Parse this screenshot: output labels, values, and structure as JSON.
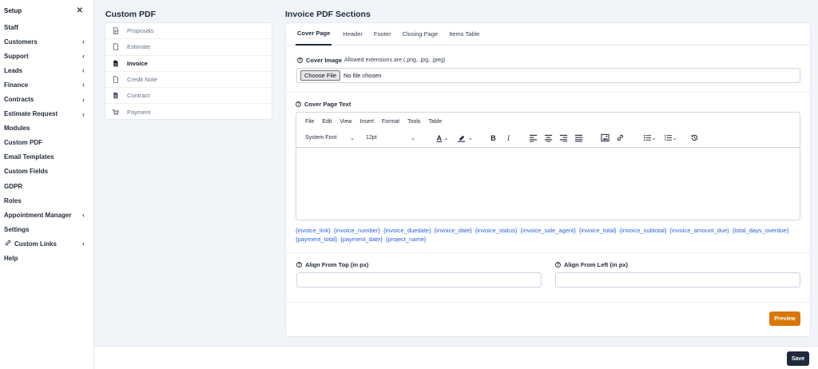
{
  "sidebar": {
    "title": "Setup",
    "close_glyph": "✕",
    "items": [
      {
        "label": "Staff",
        "chevron": false
      },
      {
        "label": "Customers",
        "chevron": true
      },
      {
        "label": "Support",
        "chevron": true
      },
      {
        "label": "Leads",
        "chevron": true
      },
      {
        "label": "Finance",
        "chevron": true
      },
      {
        "label": "Contracts",
        "chevron": true
      },
      {
        "label": "Estimate Request",
        "chevron": true
      },
      {
        "label": "Modules",
        "chevron": false
      },
      {
        "label": "Custom PDF",
        "chevron": false
      },
      {
        "label": "Email Templates",
        "chevron": false
      },
      {
        "label": "Custom Fields",
        "chevron": false
      },
      {
        "label": "GDPR",
        "chevron": false
      },
      {
        "label": "Roles",
        "chevron": false
      },
      {
        "label": "Appointment Manager",
        "chevron": true
      },
      {
        "label": "Settings",
        "chevron": false
      },
      {
        "label": "Custom Links",
        "chevron": true,
        "icon": "link-icon"
      },
      {
        "label": "Help",
        "chevron": false
      }
    ]
  },
  "custom_pdf": {
    "title": "Custom PDF",
    "items": [
      {
        "label": "Proposals",
        "icon": "document-icon",
        "active": false
      },
      {
        "label": "Estimate",
        "icon": "file-outline-icon",
        "active": false
      },
      {
        "label": "Invoice",
        "icon": "invoice-icon",
        "active": true
      },
      {
        "label": "Credit Note",
        "icon": "credit-note-icon",
        "active": false
      },
      {
        "label": "Contract",
        "icon": "contract-icon",
        "active": false
      },
      {
        "label": "Payment",
        "icon": "cart-icon",
        "active": false
      }
    ]
  },
  "sections": {
    "title": "Invoice PDF Sections",
    "tabs": [
      "Cover Page",
      "Header",
      "Footer",
      "Closing Page",
      "Items Table"
    ],
    "active_tab": 0,
    "cover_image": {
      "label": "Cover Image",
      "hint": "Allowed extensions are (.png, .jpg, .jpeg)",
      "button": "Choose File",
      "status": "No file chosen"
    },
    "cover_text": {
      "label": "Cover Page Text",
      "menus": [
        "File",
        "Edit",
        "View",
        "Insert",
        "Format",
        "Tools",
        "Table"
      ],
      "font_family": "System Font",
      "font_size": "12pt"
    },
    "merge_fields": [
      "{invoice_link}",
      "{invoice_number}",
      "{invoice_duedate}",
      "{invoice_date}",
      "{invoice_status}",
      "{invoice_sale_agent}",
      "{invoice_total}",
      "{invoice_subtotal}",
      "{invoice_amount_due}",
      "{total_days_overdue}",
      "{payment_total}",
      "{payment_date}",
      "{project_name}"
    ],
    "align_top_label": "Align From Top (in px)",
    "align_left_label": "Align From Left (in px)",
    "align_top_value": "",
    "align_left_value": "",
    "preview_label": "Preview"
  },
  "footer": {
    "save_label": "Save"
  },
  "colors": {
    "link": "#2563eb",
    "preview": "#d97706",
    "save": "#1e293b"
  }
}
